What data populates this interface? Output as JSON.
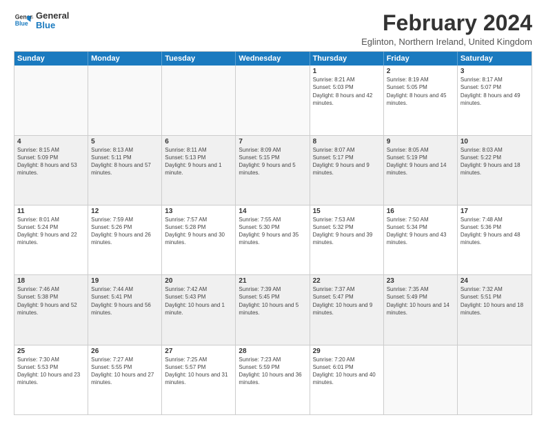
{
  "logo": {
    "line1": "General",
    "line2": "Blue"
  },
  "title": "February 2024",
  "subtitle": "Eglinton, Northern Ireland, United Kingdom",
  "headers": [
    "Sunday",
    "Monday",
    "Tuesday",
    "Wednesday",
    "Thursday",
    "Friday",
    "Saturday"
  ],
  "weeks": [
    [
      {
        "day": "",
        "sunrise": "",
        "sunset": "",
        "daylight": "",
        "empty": true
      },
      {
        "day": "",
        "sunrise": "",
        "sunset": "",
        "daylight": "",
        "empty": true
      },
      {
        "day": "",
        "sunrise": "",
        "sunset": "",
        "daylight": "",
        "empty": true
      },
      {
        "day": "",
        "sunrise": "",
        "sunset": "",
        "daylight": "",
        "empty": true
      },
      {
        "day": "1",
        "sunrise": "Sunrise: 8:21 AM",
        "sunset": "Sunset: 5:03 PM",
        "daylight": "Daylight: 8 hours and 42 minutes."
      },
      {
        "day": "2",
        "sunrise": "Sunrise: 8:19 AM",
        "sunset": "Sunset: 5:05 PM",
        "daylight": "Daylight: 8 hours and 45 minutes."
      },
      {
        "day": "3",
        "sunrise": "Sunrise: 8:17 AM",
        "sunset": "Sunset: 5:07 PM",
        "daylight": "Daylight: 8 hours and 49 minutes."
      }
    ],
    [
      {
        "day": "4",
        "sunrise": "Sunrise: 8:15 AM",
        "sunset": "Sunset: 5:09 PM",
        "daylight": "Daylight: 8 hours and 53 minutes."
      },
      {
        "day": "5",
        "sunrise": "Sunrise: 8:13 AM",
        "sunset": "Sunset: 5:11 PM",
        "daylight": "Daylight: 8 hours and 57 minutes."
      },
      {
        "day": "6",
        "sunrise": "Sunrise: 8:11 AM",
        "sunset": "Sunset: 5:13 PM",
        "daylight": "Daylight: 9 hours and 1 minute."
      },
      {
        "day": "7",
        "sunrise": "Sunrise: 8:09 AM",
        "sunset": "Sunset: 5:15 PM",
        "daylight": "Daylight: 9 hours and 5 minutes."
      },
      {
        "day": "8",
        "sunrise": "Sunrise: 8:07 AM",
        "sunset": "Sunset: 5:17 PM",
        "daylight": "Daylight: 9 hours and 9 minutes."
      },
      {
        "day": "9",
        "sunrise": "Sunrise: 8:05 AM",
        "sunset": "Sunset: 5:19 PM",
        "daylight": "Daylight: 9 hours and 14 minutes."
      },
      {
        "day": "10",
        "sunrise": "Sunrise: 8:03 AM",
        "sunset": "Sunset: 5:22 PM",
        "daylight": "Daylight: 9 hours and 18 minutes."
      }
    ],
    [
      {
        "day": "11",
        "sunrise": "Sunrise: 8:01 AM",
        "sunset": "Sunset: 5:24 PM",
        "daylight": "Daylight: 9 hours and 22 minutes."
      },
      {
        "day": "12",
        "sunrise": "Sunrise: 7:59 AM",
        "sunset": "Sunset: 5:26 PM",
        "daylight": "Daylight: 9 hours and 26 minutes."
      },
      {
        "day": "13",
        "sunrise": "Sunrise: 7:57 AM",
        "sunset": "Sunset: 5:28 PM",
        "daylight": "Daylight: 9 hours and 30 minutes."
      },
      {
        "day": "14",
        "sunrise": "Sunrise: 7:55 AM",
        "sunset": "Sunset: 5:30 PM",
        "daylight": "Daylight: 9 hours and 35 minutes."
      },
      {
        "day": "15",
        "sunrise": "Sunrise: 7:53 AM",
        "sunset": "Sunset: 5:32 PM",
        "daylight": "Daylight: 9 hours and 39 minutes."
      },
      {
        "day": "16",
        "sunrise": "Sunrise: 7:50 AM",
        "sunset": "Sunset: 5:34 PM",
        "daylight": "Daylight: 9 hours and 43 minutes."
      },
      {
        "day": "17",
        "sunrise": "Sunrise: 7:48 AM",
        "sunset": "Sunset: 5:36 PM",
        "daylight": "Daylight: 9 hours and 48 minutes."
      }
    ],
    [
      {
        "day": "18",
        "sunrise": "Sunrise: 7:46 AM",
        "sunset": "Sunset: 5:38 PM",
        "daylight": "Daylight: 9 hours and 52 minutes."
      },
      {
        "day": "19",
        "sunrise": "Sunrise: 7:44 AM",
        "sunset": "Sunset: 5:41 PM",
        "daylight": "Daylight: 9 hours and 56 minutes."
      },
      {
        "day": "20",
        "sunrise": "Sunrise: 7:42 AM",
        "sunset": "Sunset: 5:43 PM",
        "daylight": "Daylight: 10 hours and 1 minute."
      },
      {
        "day": "21",
        "sunrise": "Sunrise: 7:39 AM",
        "sunset": "Sunset: 5:45 PM",
        "daylight": "Daylight: 10 hours and 5 minutes."
      },
      {
        "day": "22",
        "sunrise": "Sunrise: 7:37 AM",
        "sunset": "Sunset: 5:47 PM",
        "daylight": "Daylight: 10 hours and 9 minutes."
      },
      {
        "day": "23",
        "sunrise": "Sunrise: 7:35 AM",
        "sunset": "Sunset: 5:49 PM",
        "daylight": "Daylight: 10 hours and 14 minutes."
      },
      {
        "day": "24",
        "sunrise": "Sunrise: 7:32 AM",
        "sunset": "Sunset: 5:51 PM",
        "daylight": "Daylight: 10 hours and 18 minutes."
      }
    ],
    [
      {
        "day": "25",
        "sunrise": "Sunrise: 7:30 AM",
        "sunset": "Sunset: 5:53 PM",
        "daylight": "Daylight: 10 hours and 23 minutes."
      },
      {
        "day": "26",
        "sunrise": "Sunrise: 7:27 AM",
        "sunset": "Sunset: 5:55 PM",
        "daylight": "Daylight: 10 hours and 27 minutes."
      },
      {
        "day": "27",
        "sunrise": "Sunrise: 7:25 AM",
        "sunset": "Sunset: 5:57 PM",
        "daylight": "Daylight: 10 hours and 31 minutes."
      },
      {
        "day": "28",
        "sunrise": "Sunrise: 7:23 AM",
        "sunset": "Sunset: 5:59 PM",
        "daylight": "Daylight: 10 hours and 36 minutes."
      },
      {
        "day": "29",
        "sunrise": "Sunrise: 7:20 AM",
        "sunset": "Sunset: 6:01 PM",
        "daylight": "Daylight: 10 hours and 40 minutes."
      },
      {
        "day": "",
        "sunrise": "",
        "sunset": "",
        "daylight": "",
        "empty": true
      },
      {
        "day": "",
        "sunrise": "",
        "sunset": "",
        "daylight": "",
        "empty": true
      }
    ]
  ]
}
